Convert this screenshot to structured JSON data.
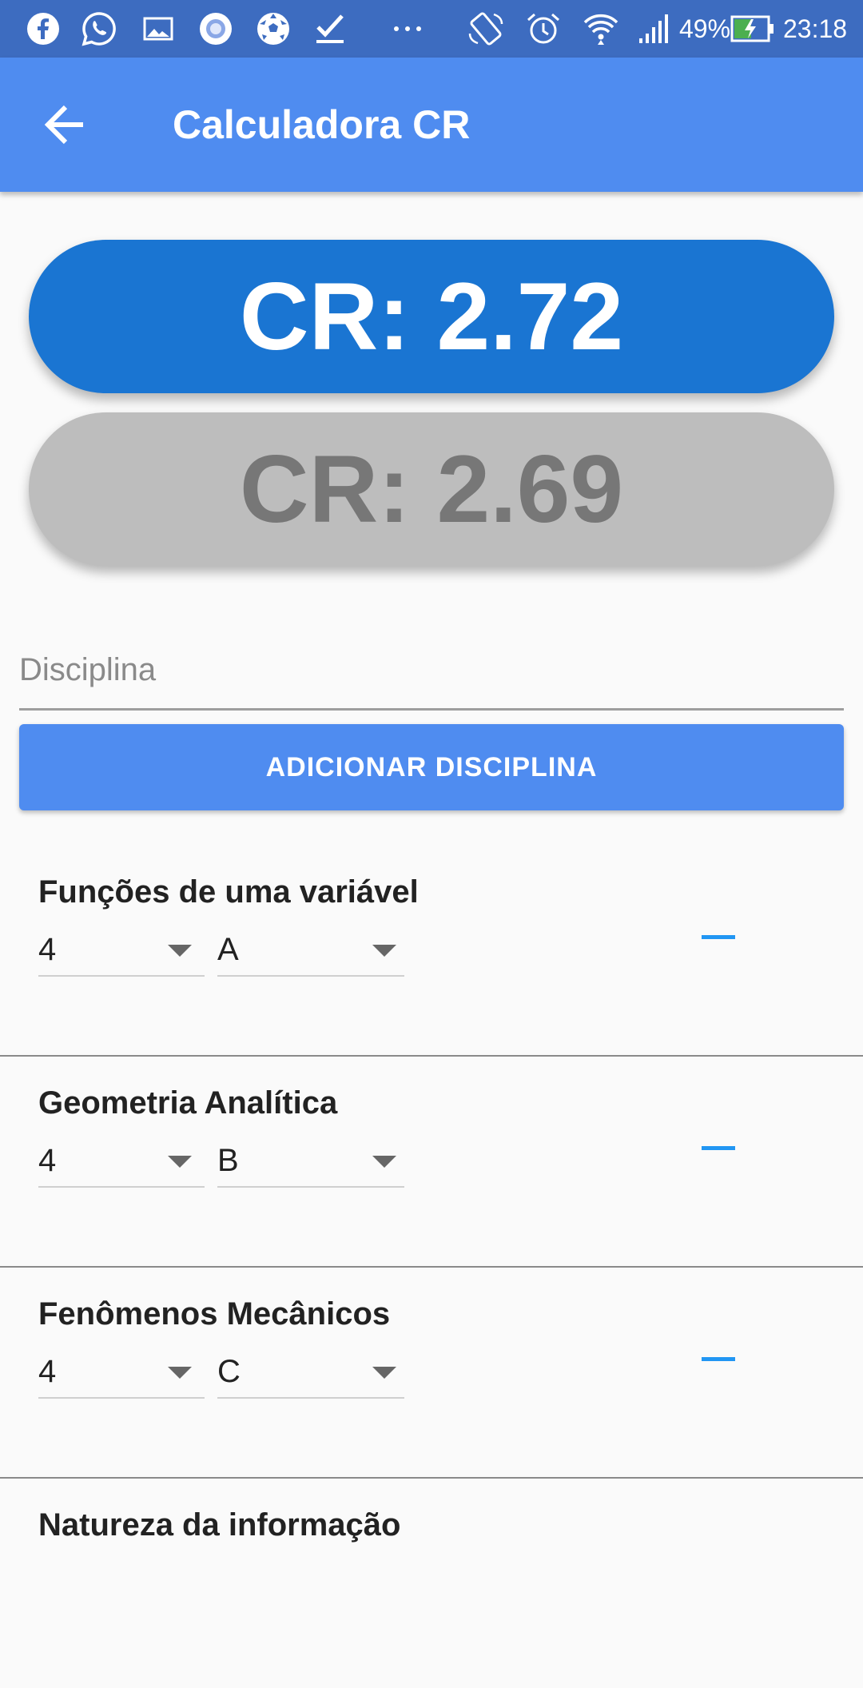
{
  "status_bar": {
    "battery": "49%",
    "time": "23:18",
    "icons": [
      "facebook-icon",
      "whatsapp-icon",
      "gallery-icon",
      "camera-icon",
      "soccer-icon",
      "checkmark-icon",
      "more-icon",
      "rotate-icon",
      "alarm-icon",
      "wifi-icon",
      "signal-icon",
      "battery-icon"
    ]
  },
  "appbar": {
    "title": "Calculadora CR"
  },
  "cr": {
    "primary": "CR: 2.72",
    "secondary": "CR: 2.69"
  },
  "form": {
    "placeholder": "Disciplina",
    "add_label": "ADICIONAR DISCIPLINA"
  },
  "courses": [
    {
      "name": "Funções de uma variável",
      "credits": "4",
      "grade": "A"
    },
    {
      "name": "Geometria Analítica",
      "credits": "4",
      "grade": "B"
    },
    {
      "name": "Fenômenos Mecânicos",
      "credits": "4",
      "grade": "C"
    },
    {
      "name": "Natureza da informação"
    }
  ],
  "colors": {
    "status_bar": "#3d6cc0",
    "app_bar": "#4f8cf0",
    "primary_pill": "#1a75d2",
    "secondary_pill": "#bdbdbd",
    "remove": "#2196f3"
  }
}
